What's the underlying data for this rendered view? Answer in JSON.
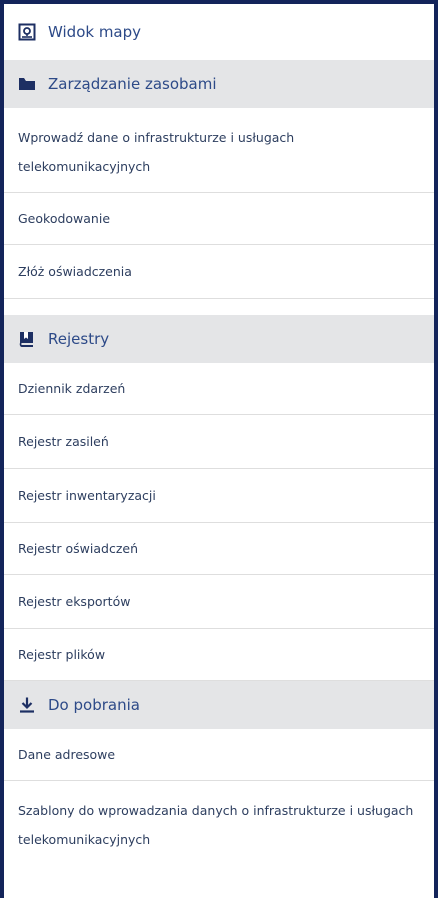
{
  "menu": {
    "map_view": {
      "label": "Widok mapy",
      "icon": "map-view-icon"
    },
    "resource_management": {
      "label": "Zarządzanie zasobami",
      "icon": "folder-icon",
      "items": [
        {
          "label": "Wprowadź dane o infrastrukturze i usługach telekomunikacyjnych"
        },
        {
          "label": "Geokodowanie"
        },
        {
          "label": "Złóż oświadczenia"
        }
      ]
    },
    "registers": {
      "label": "Rejestry",
      "icon": "bookmark-book-icon",
      "items": [
        {
          "label": "Dziennik zdarzeń"
        },
        {
          "label": "Rejestr zasileń"
        },
        {
          "label": "Rejestr inwentaryzacji"
        },
        {
          "label": "Rejestr oświadczeń"
        },
        {
          "label": "Rejestr eksportów"
        },
        {
          "label": "Rejestr plików"
        }
      ]
    },
    "downloads": {
      "label": "Do pobrania",
      "icon": "download-icon",
      "items": [
        {
          "label": "Dane adresowe"
        },
        {
          "label": "Szablony do wprowadzania danych o infrastrukturze i usługach telekomunikacyjnych"
        }
      ]
    }
  },
  "colors": {
    "frame_border": "#13245a",
    "header_bg": "#e4e5e7",
    "accent_text": "#2d4a88",
    "icon_fill": "#1d2f63",
    "item_text": "#2d3e5f",
    "divider": "#dedede"
  }
}
